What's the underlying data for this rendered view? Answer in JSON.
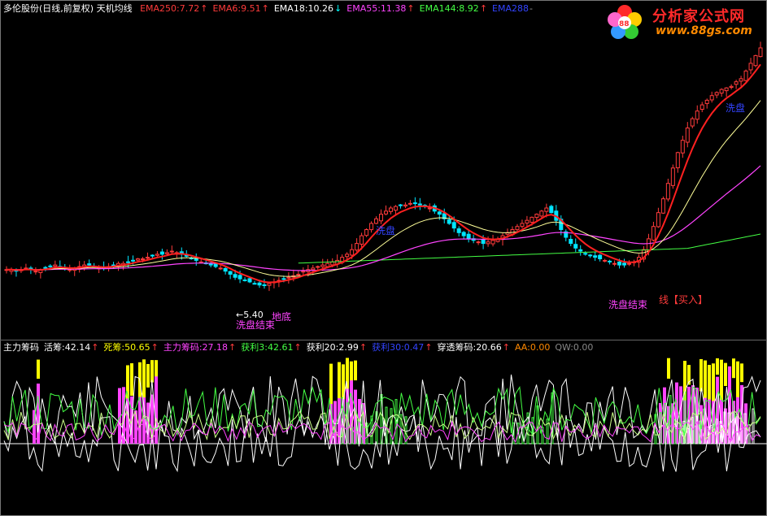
{
  "top_header": {
    "stock_title": "多伦股份(日线,前复权) 天机均线",
    "items": [
      {
        "label": "EMA250:7.72",
        "color": "#ff3b3b",
        "arrow": "↑",
        "arrow_color": "#ff3b3b"
      },
      {
        "label": "EMA6:9.51",
        "color": "#ff3b3b",
        "arrow": "↑",
        "arrow_color": "#ff3b3b"
      },
      {
        "label": "EMA18:10.26",
        "color": "#ffffff",
        "arrow": "↓",
        "arrow_color": "#00ffff"
      },
      {
        "label": "EMA55:11.38",
        "color": "#ff44ff",
        "arrow": "↑",
        "arrow_color": "#ff3b3b"
      },
      {
        "label": "EMA144:8.92",
        "color": "#44ff44",
        "arrow": "↑",
        "arrow_color": "#ff3b3b"
      },
      {
        "label": "EMA288",
        "color": "#3344ff",
        "arrow": "-",
        "arrow_color": "#999999"
      }
    ]
  },
  "logo": {
    "title": "分析家公式网",
    "url": "www.88gs.com"
  },
  "annotations": {
    "low_price": "←5.40",
    "bottom_mark": "地底",
    "wash_end_1": "洗盘结束",
    "wash_end_2": "洗盘结束",
    "line_buy": "线【买入】",
    "wash_mid": "洗盘",
    "wash_top": "洗盘"
  },
  "indicator_header": {
    "items": [
      {
        "label": "主力筹码",
        "color": "#ffffff",
        "arrow": "",
        "arrow_color": "#ffffff"
      },
      {
        "label": "活筹:42.14",
        "color": "#ffffff",
        "arrow": "↑",
        "arrow_color": "#ff3b3b"
      },
      {
        "label": "死筹:50.65",
        "color": "#ffff00",
        "arrow": "↑",
        "arrow_color": "#ff3b3b"
      },
      {
        "label": "主力筹码:27.18",
        "color": "#ff44ff",
        "arrow": "↑",
        "arrow_color": "#ff3b3b"
      },
      {
        "label": "获利3:42.61",
        "color": "#44ff44",
        "arrow": "↑",
        "arrow_color": "#ff3b3b"
      },
      {
        "label": "获利20:2.99",
        "color": "#ffffff",
        "arrow": "↑",
        "arrow_color": "#ff3b3b"
      },
      {
        "label": "获利30:0.47",
        "color": "#3344ff",
        "arrow": "↑",
        "arrow_color": "#ff3b3b"
      },
      {
        "label": "穿透筹码:20.66",
        "color": "#ffffff",
        "arrow": "↑",
        "arrow_color": "#ff3b3b"
      },
      {
        "label": "AA:0.00",
        "color": "#ff8800",
        "arrow": "",
        "arrow_color": "#ff8800"
      },
      {
        "label": "QW:0.00",
        "color": "#888888",
        "arrow": "",
        "arrow_color": "#888888"
      }
    ]
  },
  "colors": {
    "up_candle": "#ff3b3b",
    "down_candle": "#00e5ff",
    "ema6": "#ff2020",
    "ema18": "#ffff99",
    "ema55": "#ff44ff",
    "ema144": "#44ff44",
    "chip_yellow": "#ffff00",
    "chip_magenta": "#ff44ff",
    "chip_green": "#44ff44",
    "chip_white": "#ffffff"
  },
  "chart_data": {
    "type": "candlestick",
    "closes": [
      8.6,
      8.6,
      8.5,
      8.6,
      8.7,
      8.6,
      8.5,
      8.6,
      8.7,
      8.8,
      8.9,
      8.8,
      8.7,
      8.6,
      8.7,
      8.8,
      8.9,
      8.9,
      8.8,
      8.7,
      8.7,
      8.8,
      8.9,
      9.0,
      9.0,
      9.1,
      9.2,
      9.3,
      9.3,
      9.4,
      9.5,
      9.6,
      9.6,
      9.7,
      9.8,
      9.7,
      9.6,
      9.5,
      9.3,
      9.2,
      9.1,
      9.0,
      8.9,
      8.8,
      8.7,
      8.5,
      8.3,
      8.1,
      8.0,
      7.9,
      7.8,
      7.7,
      7.6,
      7.6,
      7.7,
      7.8,
      7.9,
      8.0,
      8.1,
      8.2,
      8.3,
      8.5,
      8.6,
      8.7,
      8.8,
      8.9,
      9.0,
      9.1,
      9.2,
      9.4,
      9.6,
      9.9,
      10.3,
      10.8,
      11.2,
      11.6,
      11.9,
      12.2,
      12.4,
      12.6,
      12.7,
      12.8,
      12.8,
      12.9,
      12.9,
      12.8,
      12.7,
      12.6,
      12.4,
      12.2,
      11.9,
      11.6,
      11.3,
      11.0,
      10.8,
      10.6,
      10.5,
      10.4,
      10.3,
      10.4,
      10.5,
      10.6,
      10.8,
      11.0,
      11.2,
      11.4,
      11.6,
      11.8,
      12.0,
      12.2,
      12.4,
      12.6,
      12.3,
      11.8,
      11.2,
      10.7,
      10.3,
      10.0,
      9.8,
      9.6,
      9.5,
      9.4,
      9.3,
      9.2,
      9.1,
      9.0,
      8.9,
      8.9,
      9.0,
      9.1,
      9.4,
      9.9,
      10.6,
      11.4,
      12.3,
      13.2,
      14.2,
      15.2,
      16.2,
      17.0,
      17.8,
      18.4,
      18.9,
      19.3,
      19.6,
      19.9,
      20.1,
      20.3,
      20.4,
      20.5,
      20.8,
      21.0,
      21.5,
      22.0,
      22.5,
      23.0
    ]
  }
}
